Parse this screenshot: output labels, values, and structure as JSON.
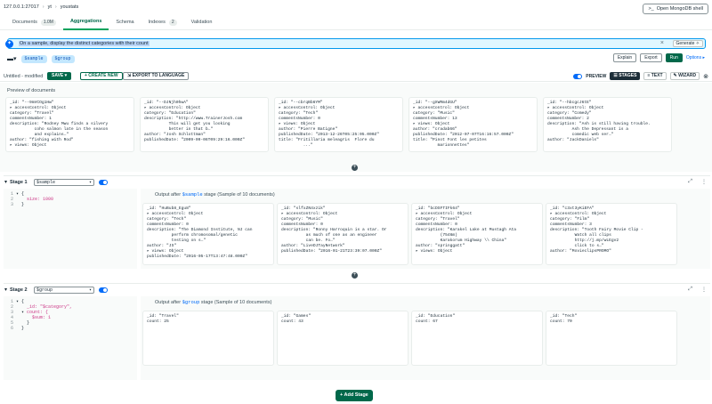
{
  "breadcrumb": {
    "host": "127.0.0.1:27017",
    "db": "yt",
    "collection": "youstats"
  },
  "tabs": [
    {
      "label": "Documents",
      "count": "1.0M"
    },
    {
      "label": "Aggregations",
      "count": ""
    },
    {
      "label": "Schema",
      "count": ""
    },
    {
      "label": "Indexes",
      "count": "2"
    },
    {
      "label": "Validation",
      "count": ""
    }
  ],
  "shell_button": "Open MongoDB shell",
  "ai": {
    "query": "On a sample, display the distinct categories with their count",
    "generate": "Generate"
  },
  "chips": {
    "stage1": "$sample",
    "stage2": "$group"
  },
  "actions": {
    "explain": "Explain",
    "export": "Export",
    "run": "Run",
    "options": "Options ▸"
  },
  "pipeline": {
    "name": "Untitled - modified",
    "save": "SAVE ▾",
    "create_new": "+ CREATE NEW",
    "export_language": "EXPORT TO LANGUAGE"
  },
  "view": {
    "preview": "PREVIEW",
    "stages": "STAGES",
    "text": "TEXT",
    "wizard": "WIZARD"
  },
  "preview_label": "Preview of documents",
  "preview_docs": [
    [
      "_id: \"--9mVCOg1Hw\"",
      "▸ accessControl: Object",
      "category: \"Travel\"",
      "commentsNumber: 1",
      "description: \"Rodney Mwu finds a silvery",
      "          coho salmon late in the season",
      "          and explains…\"",
      "author: \"fishing with Rod\"",
      "▸ views: Object"
    ],
    [
      "_id: \"--DJNjh0hwA\"",
      "▸ accessControl: Object",
      "category: \"Education\"",
      "description: \"http://www.TrainerJosh.com",
      "",
      "          This will get you looking",
      "          better in that b…\"",
      "author: \"Josh Schlottman\"",
      "publishedDate: \"2009-09-06T09:29:16.000Z\""
    ],
    [
      "_id: \"--cbrqBb6YM\"",
      "▸ accessControl: Object",
      "category: \"Tech\"",
      "commentsNumber: 0",
      "▸ views: Object",
      "author: \"Pierre Batigne\"",
      "publishedDate: \"2013-12-26T05:25:05.000Z\"",
      "title: \"Fritillaria meleagris  Flore du",
      "          ...\""
    ],
    [
      "_id: \"--gXWRm4dGU\"",
      "▸ accessControl: Object",
      "category: \"Music\"",
      "commentsNumber: 13",
      "▸ views: Object",
      "author: \"cradab66\"",
      "publishedDate: \"2012-07-07T16:16:57.000Z\"",
      "title: \"Pinot Font les petites",
      "          marionnettes\""
    ],
    [
      "_id: \"--hbcgcJ6tE\"",
      "▸ accessControl: Object",
      "category: \"Comedy\"",
      "commentsNumber: 2",
      "description: \"Ash is still having trouble.",
      "",
      "          Ash the Depressant is a",
      "          comedic web ser…\"",
      "author: \"JackDaniels\""
    ]
  ],
  "stage1": {
    "title": "Stage 1",
    "operator": "$sample",
    "code": [
      [
        "1",
        "▾ {",
        ""
      ],
      [
        "2",
        "    ",
        "size: 1000"
      ],
      [
        "3",
        "  }",
        ""
      ]
    ],
    "output_prefix": "Output after",
    "output_op": "$sample",
    "output_suffix": "stage (Sample of 10 documents)",
    "docs": [
      [
        "_id: \"HuBub8_Egu8\"",
        "▸ accessControl: Object",
        "category: \"Tech\"",
        "commentsNumber: 0",
        "description: \"The Diamond Institute, NJ can",
        "          perform chromosomal/genetic",
        "          testing on s…\"",
        "author: \"JS\"",
        "▸ views: Object",
        "publishedDate: \"2016-05-17T13:47:48.000Z\""
      ],
      [
        "_id: \"slfxZN4xzik\"",
        "▸ accessControl: Object",
        "category: \"Music\"",
        "commentsNumber: 0",
        "description: \"Ronny Harroquin is a star. Or",
        "          as much of one as an engineer",
        "          can be. Fo…\"",
        "author: \"LiveDJTayNetwork\"",
        "publishedDate: \"2016-01-21T23:39:07.000Z\""
      ],
      [
        "_id: \"bcDSFTIFk64\"",
        "▸ accessControl: Object",
        "category: \"Travel\"",
        "commentsNumber: 0",
        "description: \"Karakel Lake at Mustagh Ata",
        "          (7546m)",
        "          Karakorum Highway \\\\ China\"",
        "author: \"springgatt\"",
        "▸ views: Object"
      ],
      [
        "_id: \"c3xt3yKiEFA\"",
        "▸ accessControl: Object",
        "category: \"Film\"",
        "commentsNumber: 3",
        "description: \"Tooth Fairy Movie Clip -",
        "          Watch all clips",
        "          http://j.mp/wLEgv2",
        "          click to s…\"",
        "author: \"MovieclipsPROMO\""
      ]
    ]
  },
  "stage2": {
    "title": "Stage 2",
    "operator": "$group",
    "code": [
      [
        "1",
        "▾ {",
        ""
      ],
      [
        "2",
        "    ",
        "_id: \"$category\","
      ],
      [
        "3",
        "  ▾ ",
        "count: {"
      ],
      [
        "4",
        "      ",
        "$sum: 1"
      ],
      [
        "5",
        "    }",
        ""
      ],
      [
        "6",
        "  }",
        ""
      ]
    ],
    "output_prefix": "Output after",
    "output_op": "$group",
    "output_suffix": "stage (Sample of 10 documents)",
    "docs": [
      [
        "_id: \"Travel\"",
        "count: 25"
      ],
      [
        "_id: \"Games\"",
        "count: 43"
      ],
      [
        "_id: \"Education\"",
        "count: 67"
      ],
      [
        "_id: \"Tech\"",
        "count: 70"
      ]
    ]
  },
  "add_stage": "Add Stage",
  "colors": {
    "brand_green": "#00684a",
    "accent_blue": "#016bf8",
    "chip_bg": "#c3e7fe"
  }
}
